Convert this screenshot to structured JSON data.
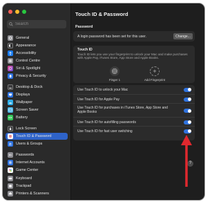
{
  "window": {
    "title": "Touch ID & Password"
  },
  "search": {
    "placeholder": "Search"
  },
  "sidebar": {
    "items": [
      {
        "label": "General",
        "icon": "gear-icon",
        "color": "#8e8e93"
      },
      {
        "label": "Appearance",
        "icon": "appearance-icon",
        "color": "#3a3a3c"
      },
      {
        "label": "Accessibility",
        "icon": "accessibility-icon",
        "color": "#1a7cf0"
      },
      {
        "label": "Control Centre",
        "icon": "control-centre-icon",
        "color": "#8e8e93"
      },
      {
        "label": "Siri & Spotlight",
        "icon": "siri-icon",
        "color": "#b04bd8"
      },
      {
        "label": "Privacy & Security",
        "icon": "hand-icon",
        "color": "#2f73e0"
      },
      {
        "label": "Desktop & Dock",
        "icon": "dock-icon",
        "color": "#3a3a3c"
      },
      {
        "label": "Displays",
        "icon": "display-icon",
        "color": "#2f73e0"
      },
      {
        "label": "Wallpaper",
        "icon": "wallpaper-icon",
        "color": "#30aee8"
      },
      {
        "label": "Screen Saver",
        "icon": "screen-saver-icon",
        "color": "#4fb6e6"
      },
      {
        "label": "Battery",
        "icon": "battery-icon",
        "color": "#34c759"
      },
      {
        "label": "Lock Screen",
        "icon": "lock-screen-icon",
        "color": "#3a3a3c"
      },
      {
        "label": "Touch ID & Password",
        "icon": "fingerprint-icon",
        "color": "#e5484d"
      },
      {
        "label": "Users & Groups",
        "icon": "users-icon",
        "color": "#2f73e0"
      },
      {
        "label": "Passwords",
        "icon": "key-icon",
        "color": "#8e8e93"
      },
      {
        "label": "Internet Accounts",
        "icon": "at-icon",
        "color": "#2f73e0"
      },
      {
        "label": "Game Center",
        "icon": "game-center-icon",
        "color": "#ffffff"
      },
      {
        "label": "Keyboard",
        "icon": "keyboard-icon",
        "color": "#8e8e93"
      },
      {
        "label": "Trackpad",
        "icon": "trackpad-icon",
        "color": "#8e8e93"
      },
      {
        "label": "Printers & Scanners",
        "icon": "printer-icon",
        "color": "#8e8e93"
      }
    ],
    "selected": "Touch ID & Password"
  },
  "password": {
    "heading": "Password",
    "status": "A login password has been set for this user.",
    "change_label": "Change..."
  },
  "touch_id": {
    "heading": "Touch ID",
    "description": "Touch ID lets you use your fingerprint to unlock your Mac and make purchases with Apple Pay, iTunes Store, App Store and Apple Books.",
    "finger_label": "Finger 1",
    "add_label": "Add Fingerprint"
  },
  "options": [
    {
      "label": "Use Touch ID to unlock your Mac",
      "on": true
    },
    {
      "label": "Use Touch ID for Apple Pay",
      "on": true
    },
    {
      "label": "Use Touch ID for purchases in iTunes Store, App Store and Apple Books",
      "on": true
    },
    {
      "label": "Use Touch ID for autofilling passwords",
      "on": true
    },
    {
      "label": "Use Touch ID for fast user switching",
      "on": true
    }
  ],
  "help": {
    "label": "?"
  },
  "annotation": {
    "arrow_color": "#e0282e"
  },
  "colors": {
    "accent": "#2f73e0",
    "selection": "#2e63c9"
  }
}
